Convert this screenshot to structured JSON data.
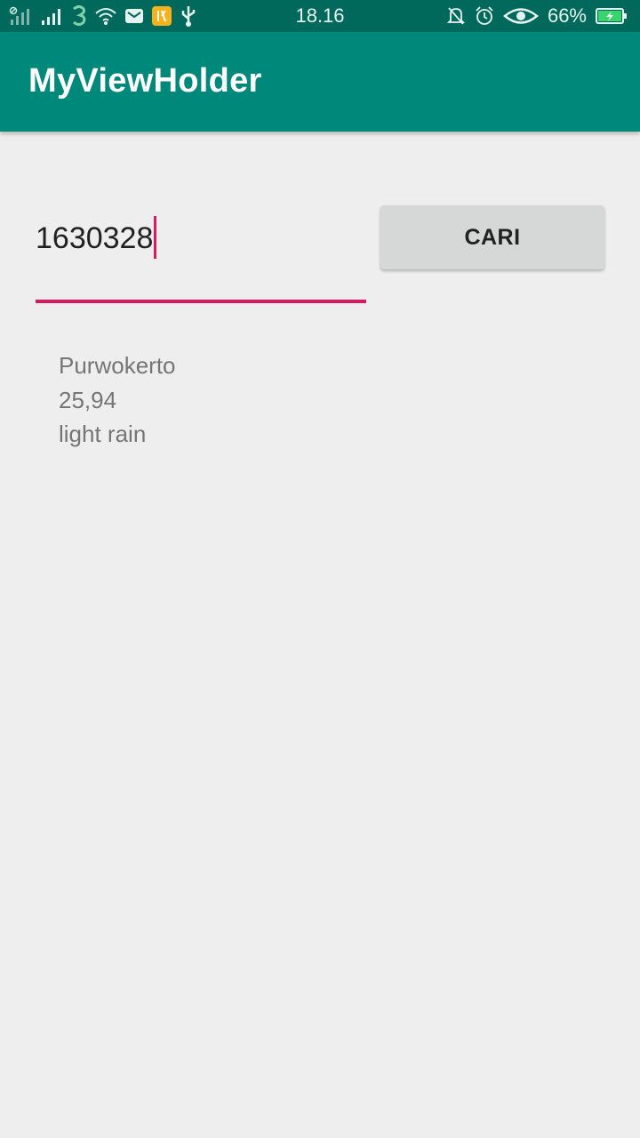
{
  "status_bar": {
    "time": "18.16",
    "battery_percent": "66%",
    "left_icons": [
      "sim1-signal-icon",
      "sim2-signal-icon",
      "carrier-3-icon",
      "wifi-icon",
      "mail-icon",
      "app-notification-icon",
      "usb-icon"
    ],
    "right_icons": [
      "bell-off-icon",
      "alarm-icon",
      "eye-icon",
      "battery-charging-icon"
    ]
  },
  "app_bar": {
    "title": "MyViewHolder",
    "color": "#00897b"
  },
  "search": {
    "input_value": "1630328",
    "button_label": "CARI",
    "accent": "#d81b60"
  },
  "result": {
    "city": "Purwokerto",
    "temperature": "25,94",
    "description": "light rain"
  }
}
